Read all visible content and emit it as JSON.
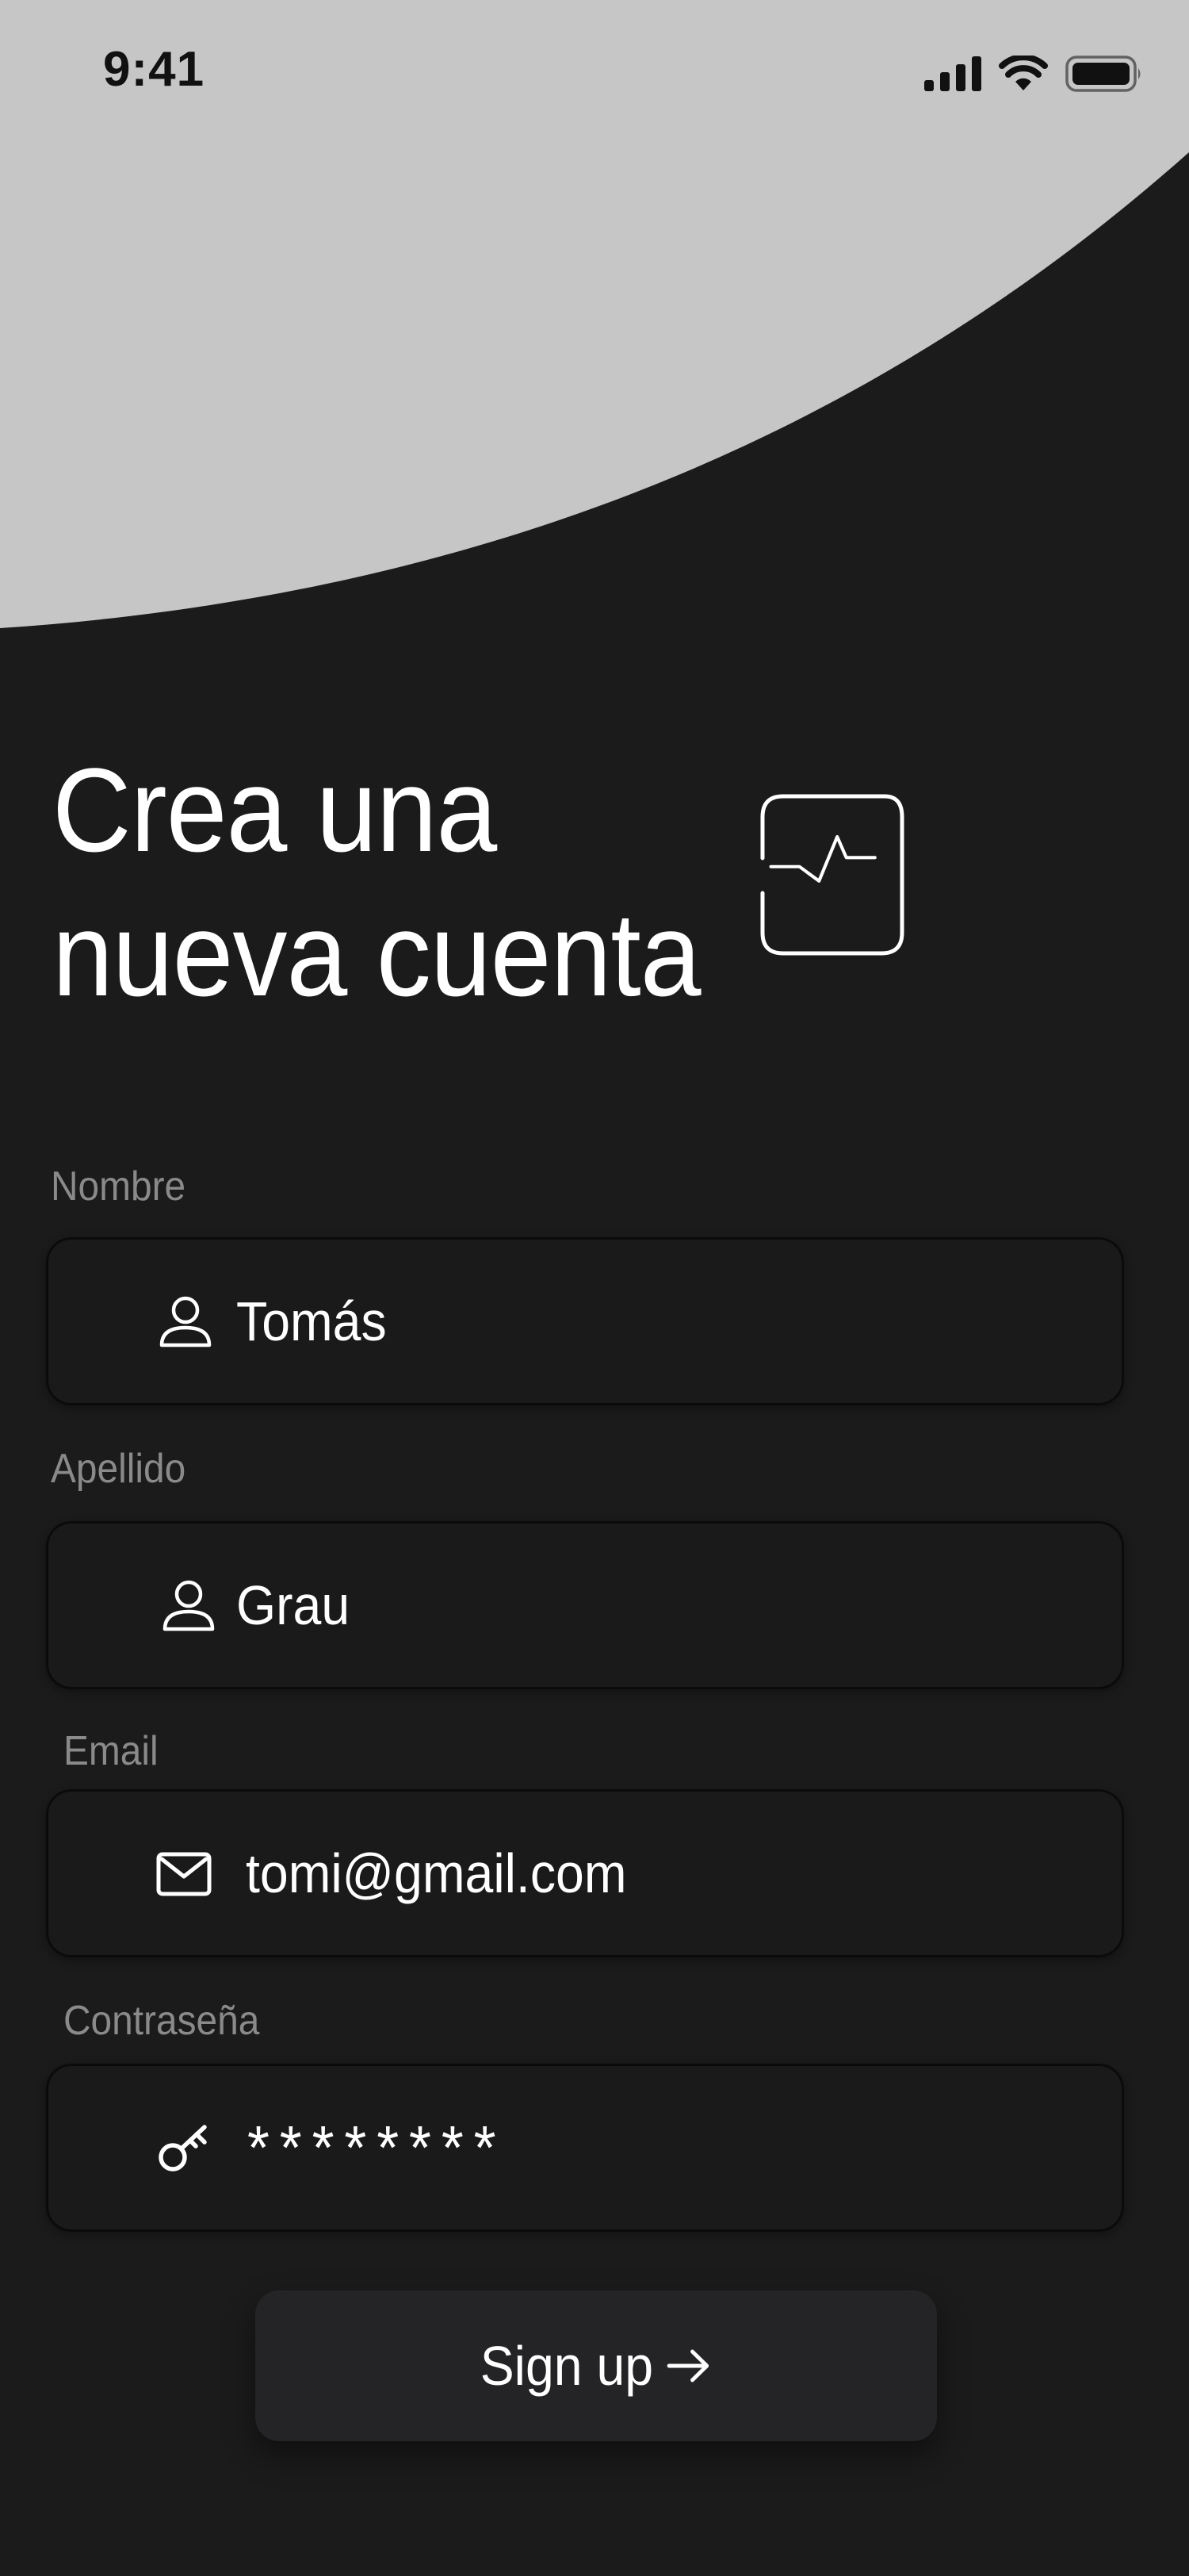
{
  "status_bar": {
    "time": "9:41",
    "icons": [
      "cellular-signal-icon",
      "wifi-icon",
      "battery-icon"
    ]
  },
  "header": {
    "title_line1": "Crea una",
    "title_line2": "nueva cuenta",
    "logo_icon": "activity-pulse-icon"
  },
  "form": {
    "first_name": {
      "label": "Nombre",
      "value": "Tomás",
      "icon": "user-icon"
    },
    "last_name": {
      "label": "Apellido",
      "value": "Grau",
      "icon": "user-icon"
    },
    "email": {
      "label": "Email",
      "value": "tomi@gmail.com",
      "icon": "mail-icon"
    },
    "password": {
      "label": "Contraseña",
      "value": "********",
      "icon": "key-icon"
    }
  },
  "actions": {
    "signup_label": "Sign up",
    "signup_icon": "arrow-right-icon"
  },
  "colors": {
    "background": "#1b1b1b",
    "header_shape": "#c6c6c6",
    "field_background": "#1a1a1a",
    "button_background": "#242426",
    "label": "#8a8a8a",
    "text": "#ffffff"
  }
}
